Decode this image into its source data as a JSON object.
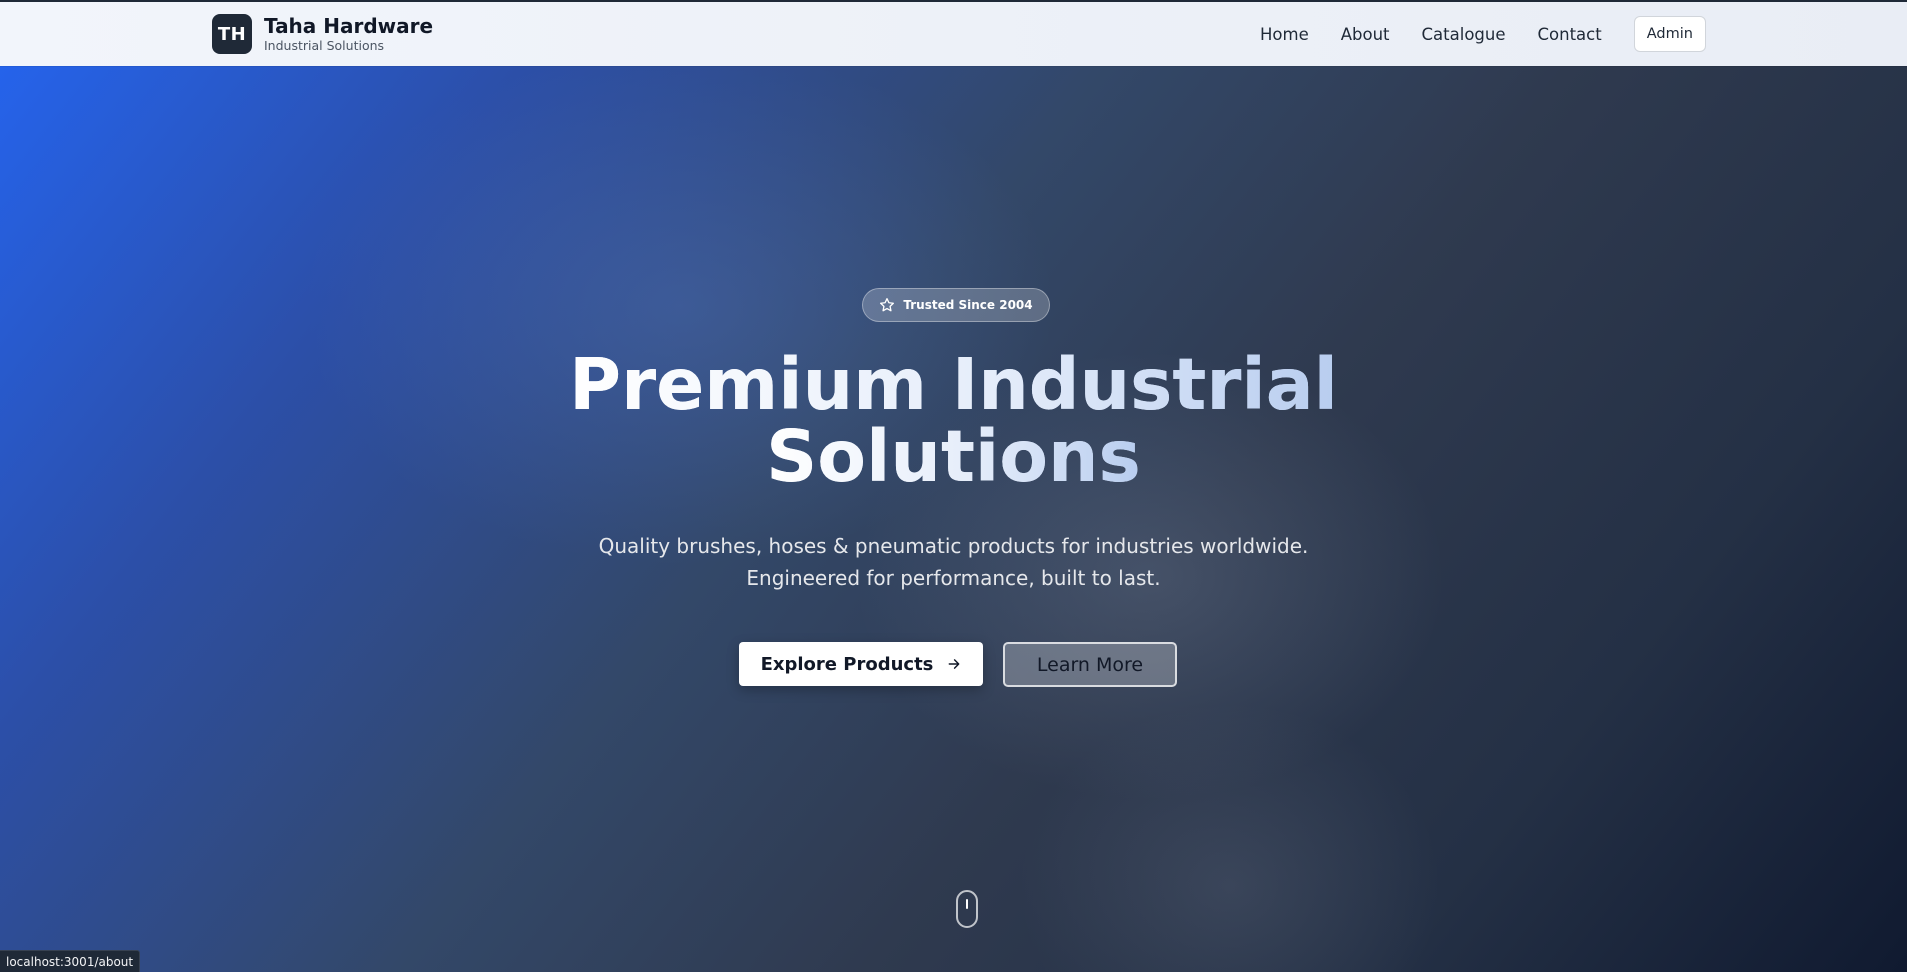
{
  "header": {
    "logo_text": "TH",
    "brand_name": "Taha Hardware",
    "brand_tagline": "Industrial Solutions",
    "nav": [
      {
        "label": "Home"
      },
      {
        "label": "About"
      },
      {
        "label": "Catalogue"
      },
      {
        "label": "Contact"
      }
    ],
    "admin_label": "Admin"
  },
  "hero": {
    "badge_text": "Trusted Since 2004",
    "badge_icon": "star-icon",
    "title_line1": "Premium Industrial",
    "title_line2": "Solutions",
    "subtitle_line1": "Quality brushes, hoses & pneumatic products for industries worldwide.",
    "subtitle_line2": "Engineered for performance, built to last.",
    "primary_button": {
      "label": "Explore Products",
      "icon": "arrow-right-icon"
    },
    "secondary_button": {
      "label": "Learn More"
    },
    "scroll_indicator_icon": "mouse-scroll-icon"
  },
  "status_bar": {
    "url": "localhost:3001/about"
  },
  "colors": {
    "header_bg": "#eef2f9",
    "logo_bg": "#1f2937",
    "hero_gradient_start": "#2563eb",
    "hero_gradient_end": "#101a30",
    "primary_button_bg": "#ffffff",
    "text_dark": "#111827"
  }
}
